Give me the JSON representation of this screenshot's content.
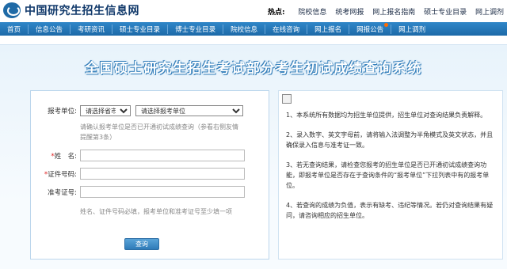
{
  "header": {
    "site_title": "中国研究生招生信息网",
    "hot_label": "热点:",
    "hot_links": [
      "院校信息",
      "统考网报",
      "网上报名指南",
      "硕士专业目录",
      "网上调剂"
    ]
  },
  "nav": {
    "items": [
      "首页",
      "信息公告",
      "考研资讯",
      "硕士专业目录",
      "博士专业目录",
      "院校信息",
      "在线咨询",
      "网上报名",
      "网报公告",
      "网上调剂"
    ]
  },
  "page": {
    "title": "全国硕士研究生招生考试部分考生初试成绩查询系统"
  },
  "form": {
    "unit_label": "报考单位:",
    "province_select": "请选择省市",
    "unit_select": "请选择报考单位",
    "unit_hint": "请确认报考单位是否已开通初试成绩查询（参看右侧友情提醒第3条）",
    "name_label": "姓　名:",
    "id_label": "证件号码:",
    "ticket_label": "准考证号:",
    "required_mark": "*",
    "bottom_hint": "姓名、证件号码必填，报考单位和准考证号至少填一项",
    "submit_label": "查询"
  },
  "notes": {
    "items": [
      "1、本系统所有数据均为招生单位提供，招生单位对查询结果负责解释。",
      "2、录入数字、英文字母前，请将输入法调整为半角模式及英文状态，并且确保录入信息与准考证一致。",
      "3、若无查询结果，请检查您报考的招生单位是否已开通初试成绩查询功能，即报考单位是否存在于查询条件的“报考单位”下拉列表中有的报考单位。",
      "4、若查询的成绩为负值，表示有缺考、违纪等情况。若仍对查询结果有疑问，请咨询相应的招生单位。"
    ]
  },
  "colors": {
    "nav_bg": "#1d6aa8",
    "title_glow": "#2f78b4",
    "required": "#e02020"
  }
}
